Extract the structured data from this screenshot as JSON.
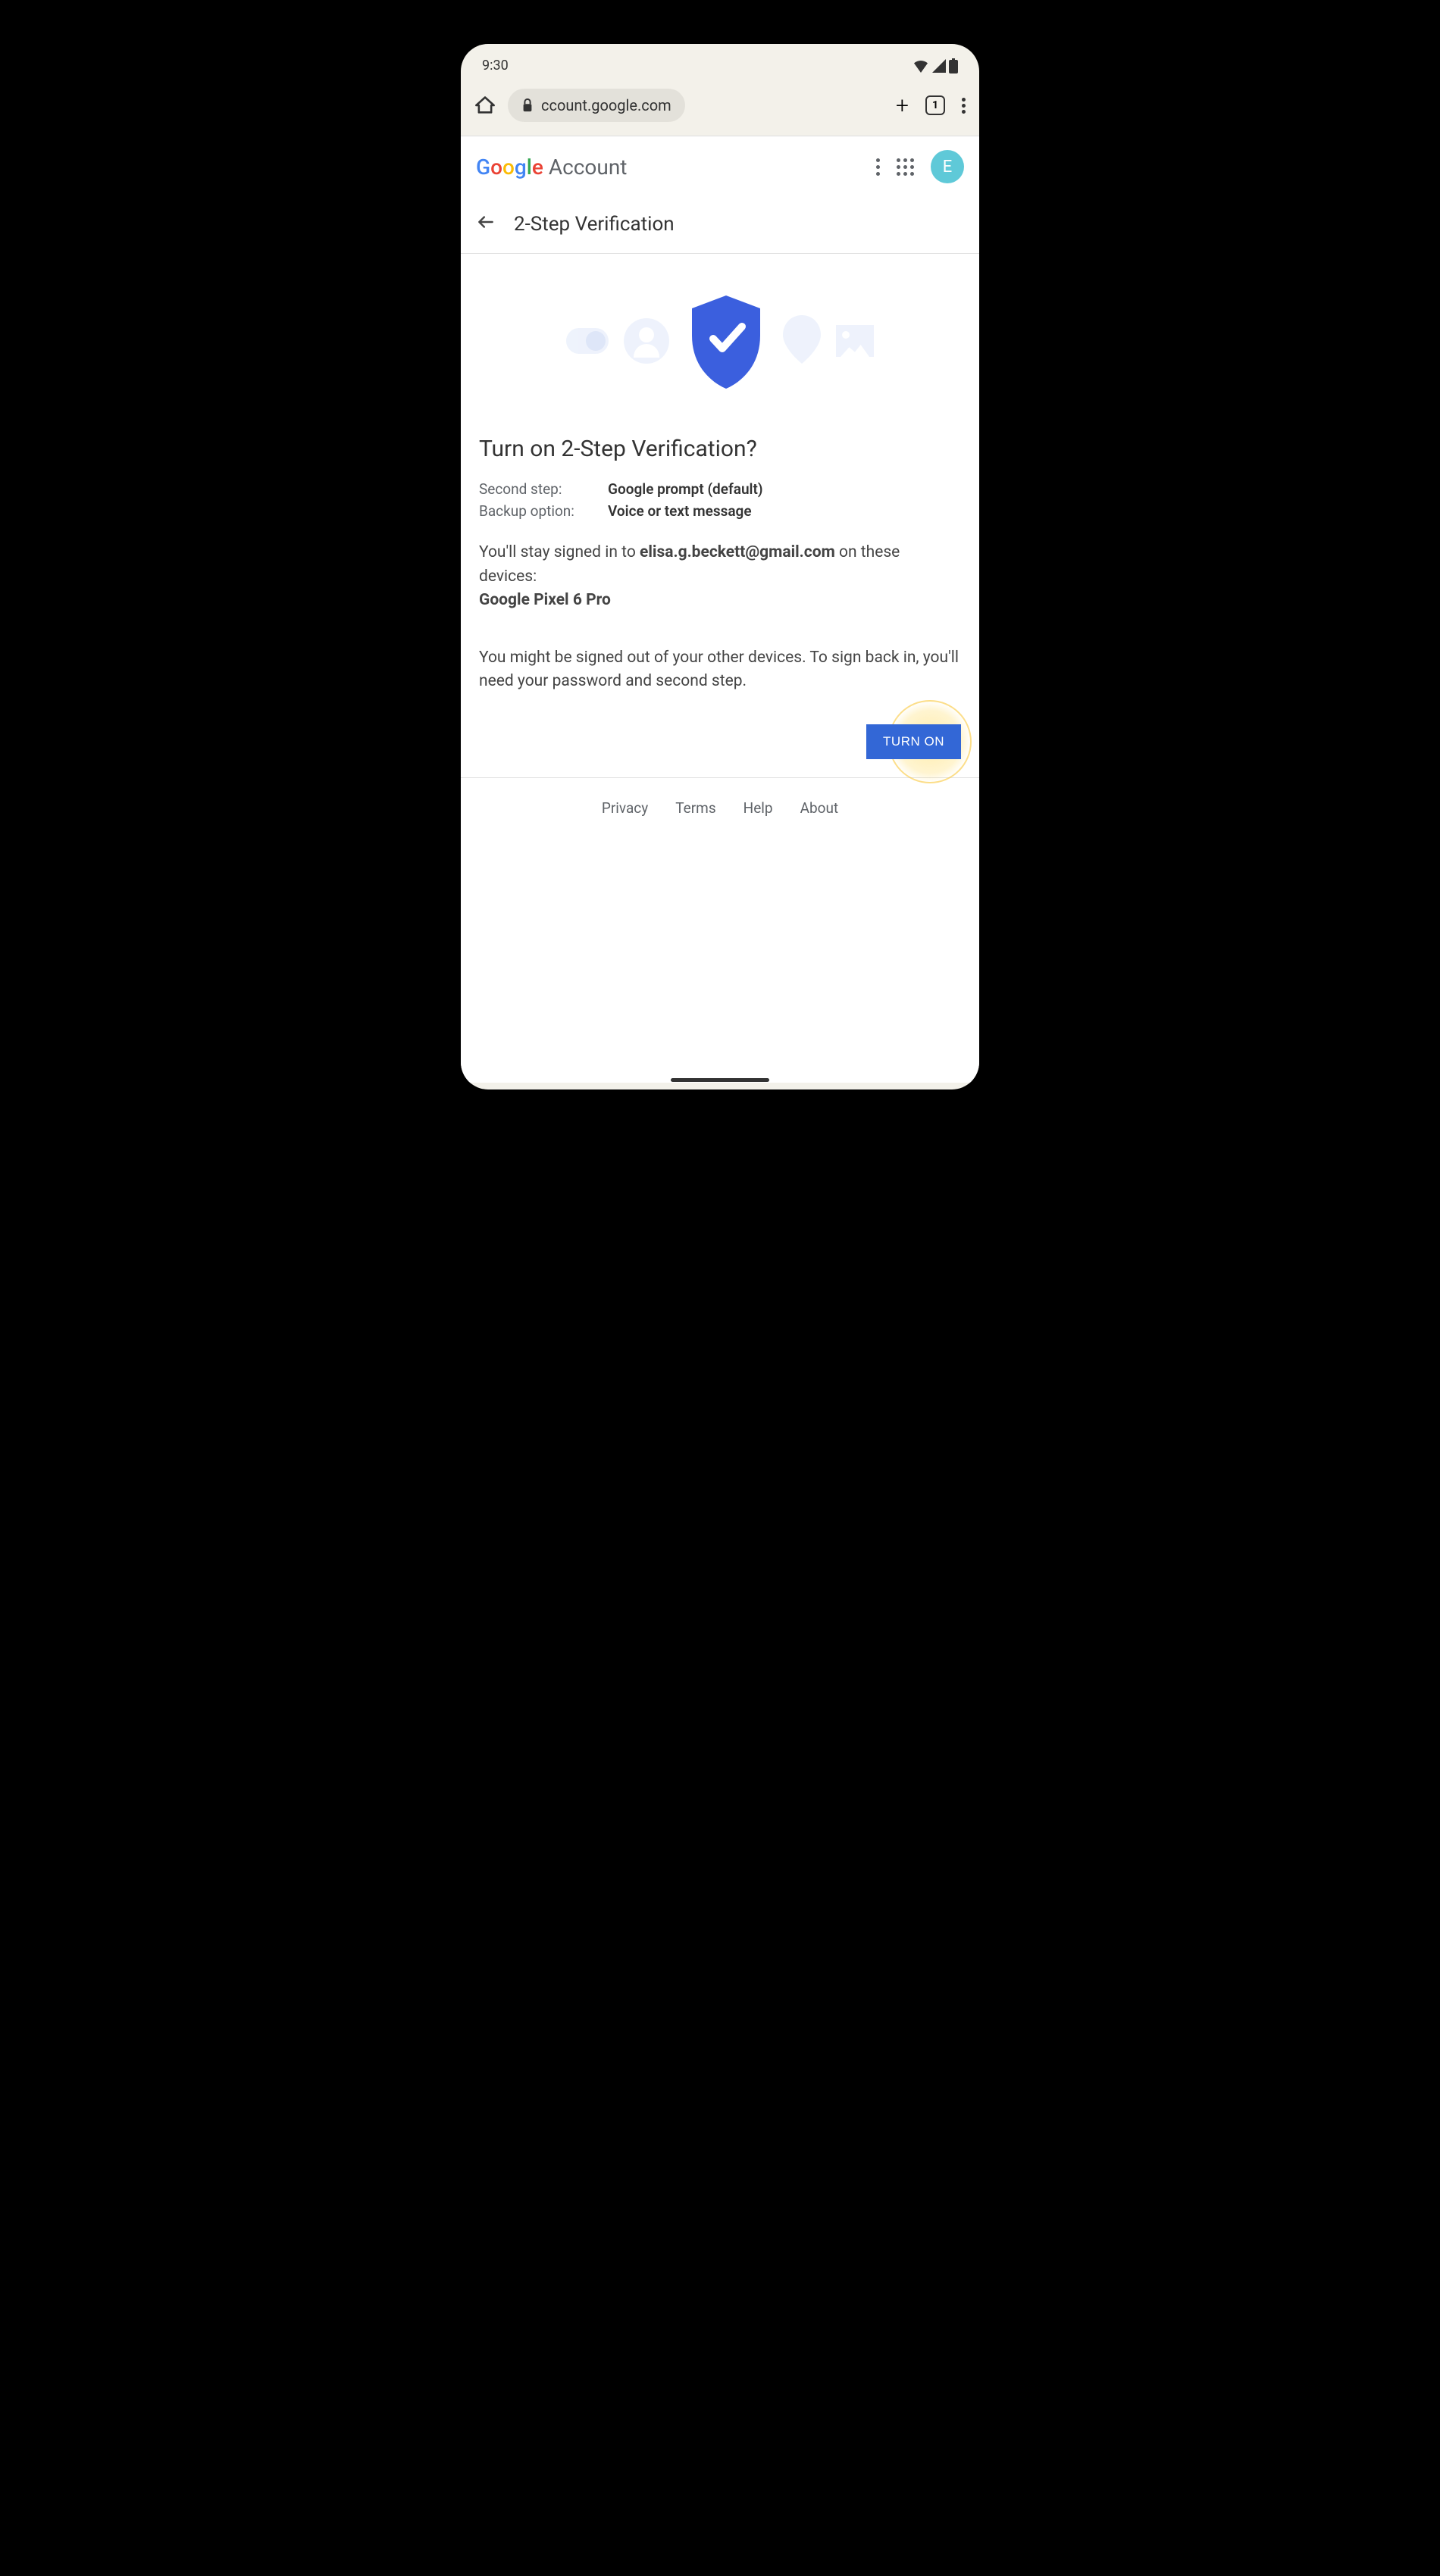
{
  "status": {
    "time": "9:30"
  },
  "browser": {
    "url": "ccount.google.com",
    "tab_count": "1"
  },
  "header": {
    "brand": "Google",
    "brand_suffix": "Account",
    "avatar_initial": "E"
  },
  "page": {
    "title": "2-Step Verification"
  },
  "main": {
    "headline": "Turn on 2-Step Verification?",
    "rows": [
      {
        "label": "Second step:",
        "value": "Google prompt (default)"
      },
      {
        "label": "Backup option:",
        "value": "Voice or text message"
      }
    ],
    "stay_signed_prefix": "You'll stay signed in to ",
    "email": "elisa.g.beckett@gmail.com",
    "stay_signed_mid": " on these devices: ",
    "device": "Google Pixel 6 Pro",
    "warning": "You might be signed out of your other devices. To sign back in, you'll need your password and second step.",
    "button": "TURN ON"
  },
  "footer": {
    "links": [
      "Privacy",
      "Terms",
      "Help",
      "About"
    ]
  }
}
